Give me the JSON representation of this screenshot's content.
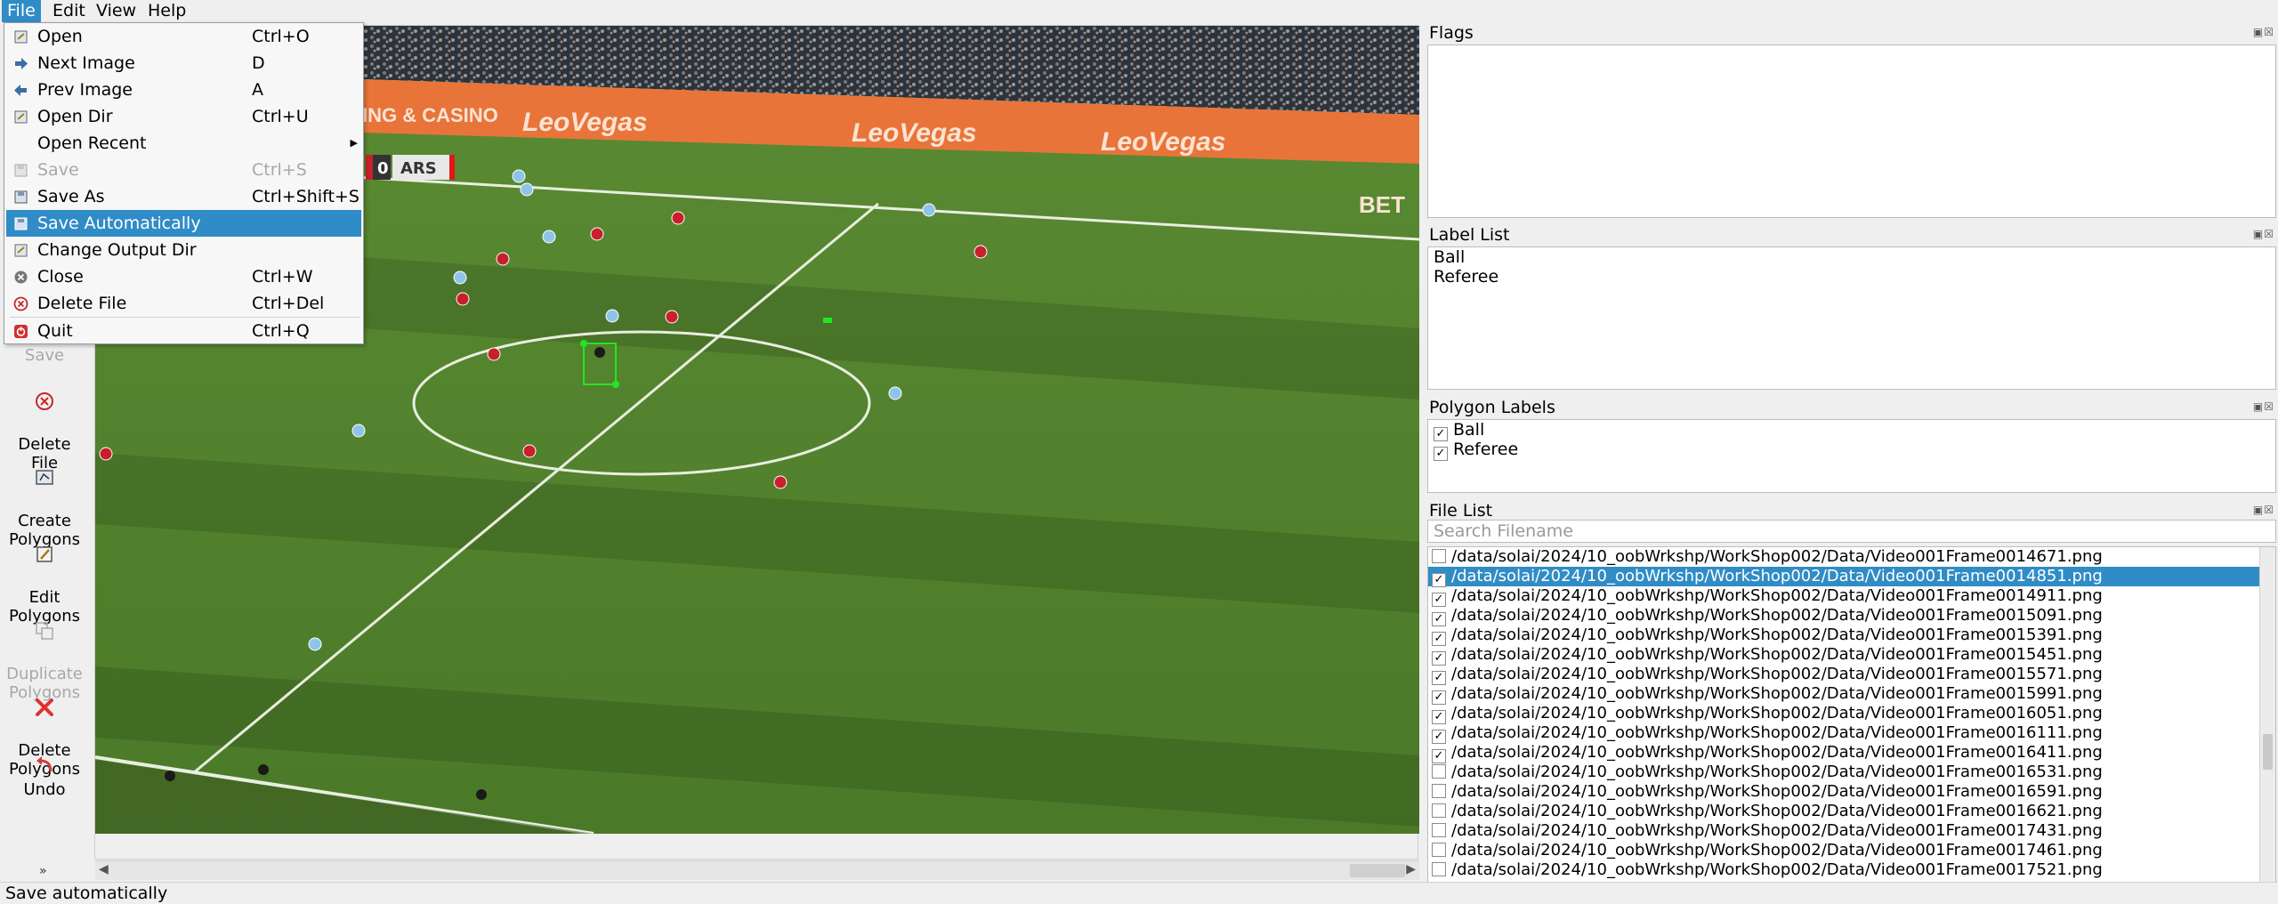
{
  "menubar": {
    "items": [
      {
        "label": "File"
      },
      {
        "label": "Edit"
      },
      {
        "label": "View"
      },
      {
        "label": "Help"
      }
    ]
  },
  "file_menu": {
    "items": [
      {
        "label": "Open",
        "shortcut": "Ctrl+O",
        "icon": "open-icon"
      },
      {
        "label": "Next Image",
        "shortcut": "D",
        "icon": "arrow-right-icon"
      },
      {
        "label": "Prev Image",
        "shortcut": "A",
        "icon": "arrow-left-icon"
      },
      {
        "label": "Open Dir",
        "shortcut": "Ctrl+U",
        "icon": "open-dir-icon"
      },
      {
        "label": "Open Recent",
        "shortcut": "",
        "icon": "submenu-arrow-icon"
      },
      {
        "label": "Save",
        "shortcut": "Ctrl+S",
        "icon": "save-icon"
      },
      {
        "label": "Save As",
        "shortcut": "Ctrl+Shift+S",
        "icon": "save-as-icon"
      },
      {
        "label": "Save Automatically",
        "shortcut": "",
        "icon": "save-auto-icon"
      },
      {
        "label": "Change Output Dir",
        "shortcut": "",
        "icon": "output-dir-icon"
      },
      {
        "label": "Close",
        "shortcut": "Ctrl+W",
        "icon": "close-icon"
      },
      {
        "label": "Delete File",
        "shortcut": "Ctrl+Del",
        "icon": "delete-file-icon"
      },
      {
        "label": "Quit",
        "shortcut": "Ctrl+Q",
        "icon": "quit-icon"
      }
    ]
  },
  "toolbar": {
    "save": "Save",
    "delete_file": "Delete\nFile",
    "create_polygons": "Create\nPolygons",
    "edit_polygons": "Edit\nPolygons",
    "duplicate_polygons": "Duplicate\nPolygons",
    "delete_polygons": "Delete\nPolygons",
    "undo": "Undo"
  },
  "canvas": {
    "scoreboard": {
      "score": "0",
      "team": "ARS"
    },
    "ad_text": "LeoVegas",
    "ad_text_left": "ING & CASINO",
    "ad_text_right": "BET"
  },
  "flags_dock": {
    "title": "Flags"
  },
  "label_list_dock": {
    "title": "Label List",
    "labels": [
      "Ball",
      "Referee"
    ]
  },
  "polygon_labels_dock": {
    "title": "Polygon Labels",
    "items": [
      {
        "label": "Ball",
        "checked": true
      },
      {
        "label": "Referee",
        "checked": true
      }
    ]
  },
  "file_list_dock": {
    "title": "File List",
    "search_placeholder": "Search Filename",
    "files": [
      {
        "path": "/data/solai/2024/10_oobWrkshp/WorkShop002/Data/Video001Frame0014671.png",
        "checked": false
      },
      {
        "path": "/data/solai/2024/10_oobWrkshp/WorkShop002/Data/Video001Frame0014851.png",
        "checked": true,
        "selected": true
      },
      {
        "path": "/data/solai/2024/10_oobWrkshp/WorkShop002/Data/Video001Frame0014911.png",
        "checked": true
      },
      {
        "path": "/data/solai/2024/10_oobWrkshp/WorkShop002/Data/Video001Frame0015091.png",
        "checked": true
      },
      {
        "path": "/data/solai/2024/10_oobWrkshp/WorkShop002/Data/Video001Frame0015391.png",
        "checked": true
      },
      {
        "path": "/data/solai/2024/10_oobWrkshp/WorkShop002/Data/Video001Frame0015451.png",
        "checked": true
      },
      {
        "path": "/data/solai/2024/10_oobWrkshp/WorkShop002/Data/Video001Frame0015571.png",
        "checked": true
      },
      {
        "path": "/data/solai/2024/10_oobWrkshp/WorkShop002/Data/Video001Frame0015991.png",
        "checked": true
      },
      {
        "path": "/data/solai/2024/10_oobWrkshp/WorkShop002/Data/Video001Frame0016051.png",
        "checked": true
      },
      {
        "path": "/data/solai/2024/10_oobWrkshp/WorkShop002/Data/Video001Frame0016111.png",
        "checked": true
      },
      {
        "path": "/data/solai/2024/10_oobWrkshp/WorkShop002/Data/Video001Frame0016411.png",
        "checked": true
      },
      {
        "path": "/data/solai/2024/10_oobWrkshp/WorkShop002/Data/Video001Frame0016531.png",
        "checked": false
      },
      {
        "path": "/data/solai/2024/10_oobWrkshp/WorkShop002/Data/Video001Frame0016591.png",
        "checked": false
      },
      {
        "path": "/data/solai/2024/10_oobWrkshp/WorkShop002/Data/Video001Frame0016621.png",
        "checked": false
      },
      {
        "path": "/data/solai/2024/10_oobWrkshp/WorkShop002/Data/Video001Frame0017431.png",
        "checked": false
      },
      {
        "path": "/data/solai/2024/10_oobWrkshp/WorkShop002/Data/Video001Frame0017461.png",
        "checked": false
      },
      {
        "path": "/data/solai/2024/10_oobWrkshp/WorkShop002/Data/Video001Frame0017521.png",
        "checked": false
      }
    ]
  },
  "status": {
    "text": "Save automatically"
  },
  "colors": {
    "accent": "#308cc6",
    "pitch": "#4f7f2c",
    "annotation": "#22e622",
    "away_team": "#c8202a",
    "home_team": "#8fc4ea"
  }
}
